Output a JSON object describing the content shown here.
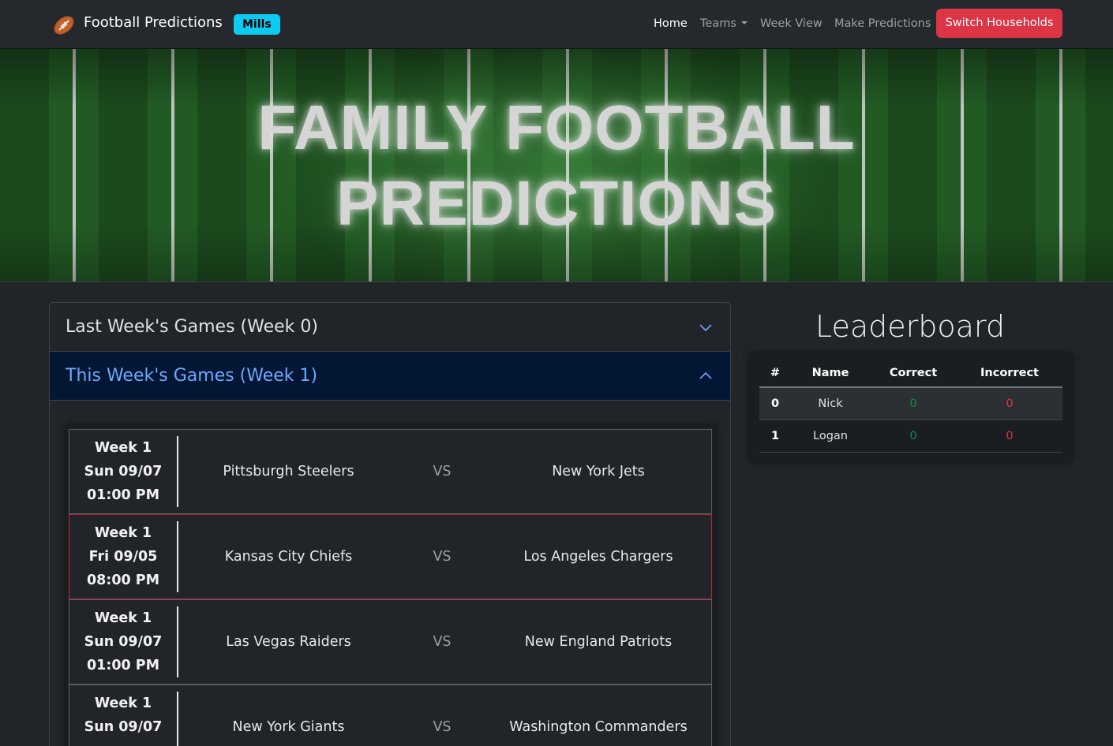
{
  "navbar": {
    "brand": "Football Predictions",
    "household": "Mills",
    "links": {
      "home": "Home",
      "teams": "Teams",
      "week_view": "Week View",
      "make_predictions": "Make Predictions"
    },
    "switch_button": "Switch Households"
  },
  "hero": {
    "line1": "FAMILY FOOTBALL",
    "line2": "PREDICTIONS"
  },
  "accordion": {
    "last_week": "Last Week's Games (Week 0)",
    "this_week": "This Week's Games (Week 1)"
  },
  "games": [
    {
      "week": "Week 1",
      "date": "Sun 09/07",
      "time": "01:00 PM",
      "home": "Pittsburgh Steelers",
      "vs": "VS",
      "away": "New York Jets"
    },
    {
      "week": "Week 1",
      "date": "Fri 09/05",
      "time": "08:00 PM",
      "home": "Kansas City Chiefs",
      "vs": "VS",
      "away": "Los Angeles Chargers"
    },
    {
      "week": "Week 1",
      "date": "Sun 09/07",
      "time": "01:00 PM",
      "home": "Las Vegas Raiders",
      "vs": "VS",
      "away": "New England Patriots"
    },
    {
      "week": "Week 1",
      "date": "Sun 09/07",
      "time": "",
      "home": "New York Giants",
      "vs": "VS",
      "away": "Washington Commanders"
    }
  ],
  "leaderboard": {
    "title": "Leaderboard",
    "headers": {
      "rank": "#",
      "name": "Name",
      "correct": "Correct",
      "incorrect": "Incorrect"
    },
    "rows": [
      {
        "rank": "0",
        "name": "Nick",
        "correct": "0",
        "incorrect": "0"
      },
      {
        "rank": "1",
        "name": "Logan",
        "correct": "0",
        "incorrect": "0"
      }
    ]
  },
  "colors": {
    "badge": "#0dcaf0",
    "switch_button": "#dc3545",
    "active_accordion_bg": "#031633",
    "active_accordion_text": "#6ea8fe",
    "correct": "#198754",
    "incorrect": "#dc3545"
  },
  "icons": {
    "brand": "football-icon",
    "last_week_toggle": "chevron-down-icon",
    "this_week_toggle": "chevron-up-icon",
    "teams_dropdown": "caret-down-icon"
  }
}
